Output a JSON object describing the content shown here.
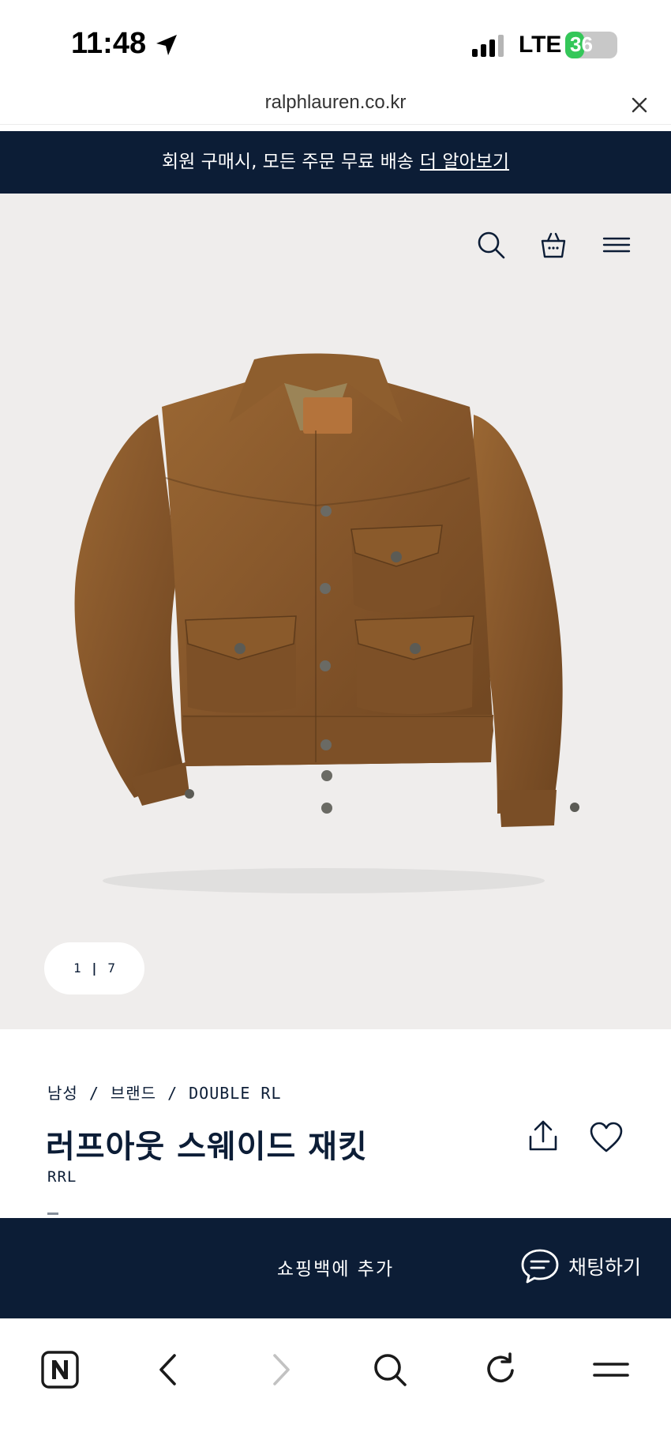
{
  "status_bar": {
    "time": "11:48",
    "network": "LTE",
    "battery_level": 36,
    "battery_text": "36"
  },
  "browser": {
    "url": "ralphlauren.co.kr"
  },
  "promo": {
    "text": "회원 구매시, 모든 주문 무료 배송",
    "link": "더 알아보기"
  },
  "gallery": {
    "current": "1",
    "total": "7"
  },
  "product": {
    "breadcrumb": [
      "남성",
      "브랜드",
      "DOUBLE RL"
    ],
    "breadcrumb_separator": "/",
    "title": "러프아웃 스웨이드 재킷",
    "brand": "RRL"
  },
  "cta": {
    "add_to_bag": "쇼핑백에 추가",
    "chat": "채팅하기"
  },
  "colors": {
    "navy": "#0c1d36",
    "hero_bg": "#efedec",
    "jacket": "#8a5a2b"
  }
}
